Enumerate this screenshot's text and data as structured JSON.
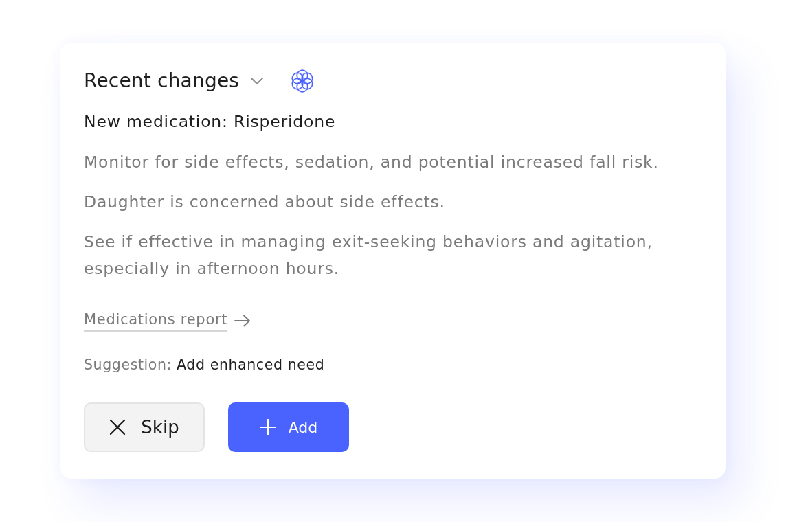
{
  "card": {
    "title": "Recent changes",
    "subtitle": "New medication: Risperidone",
    "notes": [
      "Monitor for side effects, sedation, and potential increased fall risk.",
      "Daughter is concerned about side effects.",
      "See if effective in managing exit-seeking behaviors and agitation, especially in afternoon hours."
    ],
    "link": "Medications report",
    "suggestion": {
      "label": "Suggestion:",
      "value": "Add enhanced need"
    },
    "buttons": [
      {
        "kind": "secondary",
        "label": "Skip"
      },
      {
        "kind": "primary",
        "label": "Add"
      }
    ]
  }
}
